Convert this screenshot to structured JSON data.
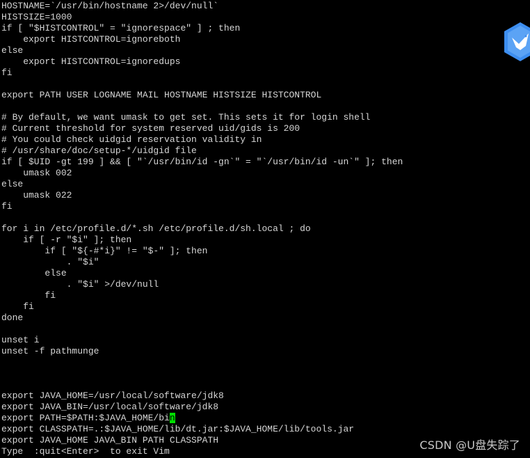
{
  "terminal": {
    "lines": [
      "HOSTNAME=`/usr/bin/hostname 2>/dev/null`",
      "HISTSIZE=1000",
      "if [ \"$HISTCONTROL\" = \"ignorespace\" ] ; then",
      "    export HISTCONTROL=ignoreboth",
      "else",
      "    export HISTCONTROL=ignoredups",
      "fi",
      "",
      "export PATH USER LOGNAME MAIL HOSTNAME HISTSIZE HISTCONTROL",
      "",
      "# By default, we want umask to get set. This sets it for login shell",
      "# Current threshold for system reserved uid/gids is 200",
      "# You could check uidgid reservation validity in",
      "# /usr/share/doc/setup-*/uidgid file",
      "if [ $UID -gt 199 ] && [ \"`/usr/bin/id -gn`\" = \"`/usr/bin/id -un`\" ]; then",
      "    umask 002",
      "else",
      "    umask 022",
      "fi",
      "",
      "for i in /etc/profile.d/*.sh /etc/profile.d/sh.local ; do",
      "    if [ -r \"$i\" ]; then",
      "        if [ \"${-#*i}\" != \"$-\" ]; then",
      "            . \"$i\"",
      "        else",
      "            . \"$i\" >/dev/null",
      "        fi",
      "    fi",
      "done",
      "",
      "unset i",
      "unset -f pathmunge",
      "",
      "",
      "",
      "export JAVA_HOME=/usr/local/software/jdk8",
      "export JAVA_BIN=/usr/local/software/jdk8",
      "export PATH=$PATH:$JAVA_HOME/bi",
      "export CLASSPATH=.:$JAVA_HOME/lib/dt.jar:$JAVA_HOME/lib/tools.jar",
      "export JAVA_HOME JAVA_BIN PATH CLASSPATH",
      "Type  :quit<Enter>  to exit Vim"
    ],
    "cursor": {
      "line_index": 37,
      "char": "n"
    }
  },
  "watermark": "CSDN @U盘失踪了",
  "logo": {
    "icon": "bird-hexagon-logo",
    "color": "#3d8ef0"
  },
  "colors": {
    "background": "#000000",
    "text": "#d6d6d6",
    "cursor": "#00e000"
  }
}
